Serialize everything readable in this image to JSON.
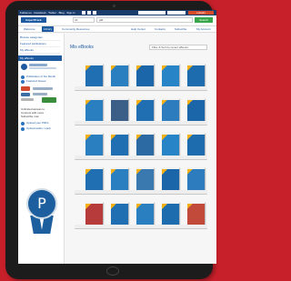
{
  "topbar": {
    "links": "Follow us  ·  Facebook  ·  Twitter  ·  Blog  ·  Sign in",
    "login_label": "LOGIN"
  },
  "header": {
    "logo_text": "ExpertTrack",
    "select_value": "All",
    "search_value": "pdf",
    "search_button_label": "Search"
  },
  "nav": {
    "items": [
      "Welcome",
      "Library",
      "Community Resources",
      "Help Center",
      "Contacts",
      "Subscribe",
      "My Account"
    ]
  },
  "sidebar": {
    "items": [
      "Browse categories",
      "Featured publications",
      "My eBooks"
    ],
    "heading": "My eBooks",
    "links": [
      "Publication of the Month",
      "Featured Issues"
    ],
    "promo_lines": [
      "Unlimited access to",
      "Connect with more",
      "Subscribe now"
    ],
    "bottom_links": [
      "Upload your PDFs",
      "Upload audio / epub"
    ]
  },
  "main": {
    "title": "Mis eBooks",
    "sort_value": "Filter & Sort by recent eBooks"
  },
  "colors": {
    "accent": "#1e5aa0",
    "frame": "#c8202a",
    "login": "#d64c2a",
    "search_button": "#3aa64a",
    "corner_tag": "#f3b017"
  },
  "icons": {
    "medal": "p-ribbon-medal-icon"
  }
}
